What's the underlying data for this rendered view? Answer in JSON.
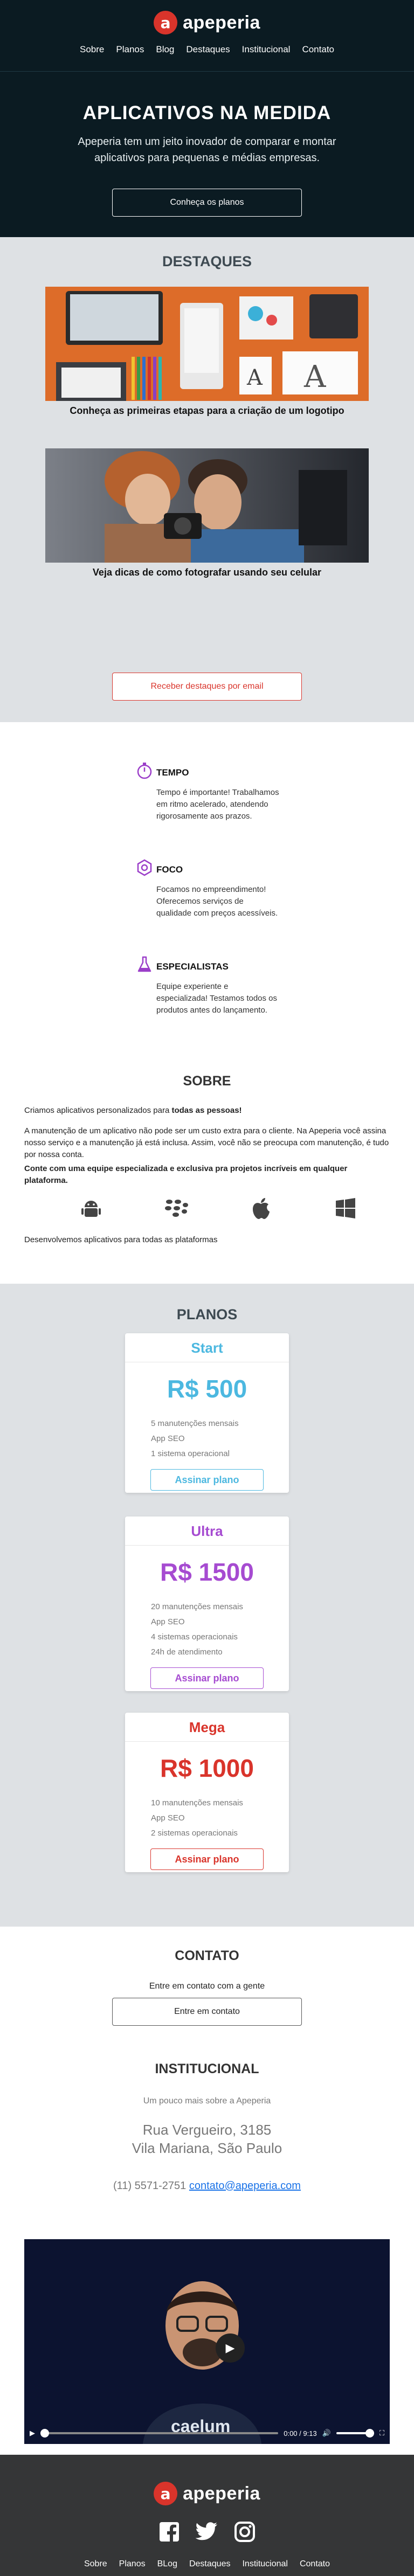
{
  "brand": {
    "name": "apeperia",
    "mark": "a",
    "color": "#d9342b"
  },
  "nav": [
    "Sobre",
    "Planos",
    "Blog",
    "Destaques",
    "Institucional",
    "Contato"
  ],
  "hero": {
    "title": "APLICATIVOS NA MEDIDA",
    "subtitle": "Apeperia tem um jeito inovador de comparar e montar aplicativos para pequenas e médias empresas.",
    "cta": "Conheça os planos"
  },
  "destaques": {
    "title": "DESTAQUES",
    "items": [
      {
        "caption": "Conheça as primeiras etapas para a criação de um logotipo",
        "image": "designer-desk-photo"
      },
      {
        "caption": "Veja dicas de como fotografar usando seu celular",
        "image": "photographers-photo"
      }
    ],
    "cta": "Receber destaques por email"
  },
  "features": [
    {
      "icon": "stopwatch-icon",
      "title": "TEMPO",
      "text": "Tempo é importante! Trabalhamos em ritmo acelerado, atendendo rigorosamente aos prazos."
    },
    {
      "icon": "target-icon",
      "title": "FOCO",
      "text": "Focamos no empreendimento! Oferecemos serviços de qualidade com preços acessíveis."
    },
    {
      "icon": "flask-icon",
      "title": "ESPECIALISTAS",
      "text": "Equipe experiente e especializada! Testamos todos os produtos antes do lançamento."
    }
  ],
  "sobre": {
    "title": "SOBRE",
    "p1_lead": "Criamos aplicativos personalizados para ",
    "p1_bold": "todas as pessoas!",
    "p2": "A manutenção de um aplicativo não pode ser um custo extra para o cliente. Na Apeperia você assina nosso serviço e a manutenção já está inclusa. Assim, você não se preocupa com manutenção, é tudo por nossa conta.",
    "p3": "Conte com uma equipe especializada e exclusiva pra projetos incríveis em qualquer plataforma.",
    "platforms": [
      "android-icon",
      "blackberry-icon",
      "apple-icon",
      "windows-icon"
    ],
    "p4": "Desenvolvemos aplicativos para todas as plataformas"
  },
  "planos": {
    "title": "PLANOS",
    "plans": [
      {
        "name": "Start",
        "price": "R$ 500",
        "color": "#4cb8e0",
        "features": [
          "5 manutenções mensais",
          "App SEO",
          "1 sistema operacional"
        ],
        "cta": "Assinar plano"
      },
      {
        "name": "Ultra",
        "price": "R$ 1500",
        "color": "#a64bd1",
        "features": [
          "20 manutenções mensais",
          "App SEO",
          "4 sistemas operacionais",
          "24h de atendimento"
        ],
        "cta": "Assinar plano"
      },
      {
        "name": "Mega",
        "price": "R$ 1000",
        "color": "#d9342b",
        "features": [
          "10 manutenções mensais",
          "App SEO",
          "2 sistemas operacionais"
        ],
        "cta": "Assinar plano"
      }
    ]
  },
  "contato": {
    "title": "CONTATO",
    "subtitle": "Entre em contato com a gente",
    "cta": "Entre em contato"
  },
  "institucional": {
    "title": "INSTITUCIONAL",
    "subtitle": "Um pouco mais sobre a Apeperia",
    "address_line1": "Rua Vergueiro, 3185",
    "address_line2": "Vila Mariana, São Paulo",
    "phone": "(11) 5571-2751",
    "email": "contato@apeperia.com"
  },
  "video": {
    "time": "0:00",
    "duration": "9:13",
    "shirt_text": "caelum",
    "progress": 0,
    "volume": 1
  },
  "footer": {
    "social": [
      "facebook-icon",
      "twitter-icon",
      "instagram-icon"
    ],
    "nav": [
      "Sobre",
      "Planos",
      "BLog",
      "Destaques",
      "Institucional",
      "Contato"
    ]
  }
}
